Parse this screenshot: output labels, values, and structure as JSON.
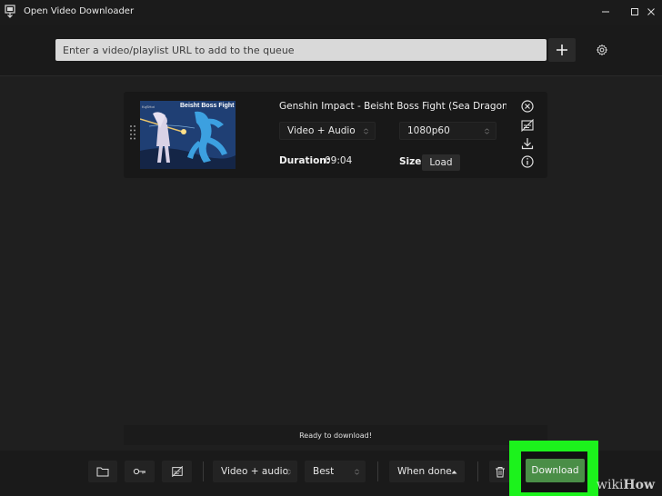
{
  "window": {
    "title": "Open Video Downloader",
    "controls": [
      "minimize",
      "maximize",
      "close"
    ]
  },
  "toolbar": {
    "url_placeholder": "Enter a video/playlist URL to add to the queue",
    "add_icon": "plus-icon",
    "settings_icon": "gear-icon"
  },
  "queue": {
    "items": [
      {
        "title": "Genshin Impact - Beisht Boss Fight (Sea Dragon vs",
        "thumbnail_text": "Beisht Boss Fight",
        "format": "Video + Audio",
        "quality": "1080p60",
        "duration_label": "Duration:",
        "duration": "09:04",
        "size_label": "Size:",
        "size_button": "Load",
        "actions": [
          "close-circle-icon",
          "no-subtitles-icon",
          "download-icon",
          "info-icon"
        ]
      }
    ]
  },
  "status": {
    "text": "Ready to download!"
  },
  "bottom_bar": {
    "folder_icon": "folder-icon",
    "key_icon": "key-icon",
    "subtitles_icon": "no-subtitles-icon",
    "format": "Video + audio",
    "quality": "Best",
    "when_done": "When done",
    "trash_icon": "trash-icon",
    "download_label": "Download"
  },
  "watermark": {
    "text_light": "wiki",
    "text_bold": "How"
  },
  "colors": {
    "background": "#1f1f1f",
    "download_green": "#4a8e47",
    "highlight_green": "#1cf21c",
    "input_bg": "#d9d9d9"
  }
}
